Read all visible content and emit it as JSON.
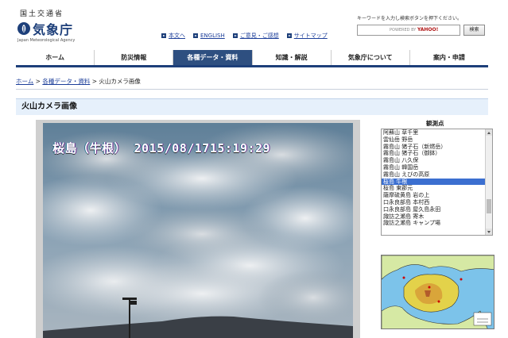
{
  "logo": {
    "ministry": "国土交通省",
    "name": "気象庁",
    "name_en": "Japan Meteorological Agency"
  },
  "toplinks": [
    "本文へ",
    "ENGLISH",
    "ご意見・ご感想",
    "サイトマップ"
  ],
  "search": {
    "hint": "キーワードを入力し検索ボタンを押下ください。",
    "powered_by": "POWERED BY",
    "brand": "YAHOO!",
    "button": "検索"
  },
  "nav": {
    "items": [
      "ホーム",
      "防災情報",
      "各種データ・資料",
      "知識・解説",
      "気象庁について",
      "案内・申請"
    ],
    "active_index": 2
  },
  "breadcrumb": {
    "home": "ホーム",
    "sep": " > ",
    "data": "各種データ・資料",
    "current": "火山カメラ画像"
  },
  "page_title": "火山カメラ画像",
  "camera": {
    "stamp": "桜島（牛根） 2015/08/1715:19:29"
  },
  "observation": {
    "label": "観測点",
    "items": [
      "阿蘇山 草千里",
      "雲仙岳 野岳",
      "霧島山 猪子石（新燃岳）",
      "霧島山 猪子石（御鉢）",
      "霧島山 八久保",
      "霧島山 韓国岳",
      "霧島山 えびの高原",
      "桜島 牛根",
      "桜島 東郡元",
      "薩摩硫黄島 岩の上",
      "口永良部島 本村西",
      "口永良部島 屋久島永田",
      "諏訪之瀬島 寄木",
      "諏訪之瀬島 キャンプ場"
    ],
    "selected_index": 7
  },
  "colors": {
    "brand": "#1d3f7a",
    "nav_active": "#2e4f80",
    "title_bar": "#e6f0fb",
    "selected": "#3b6fd0",
    "link": "#1d3f9a"
  }
}
